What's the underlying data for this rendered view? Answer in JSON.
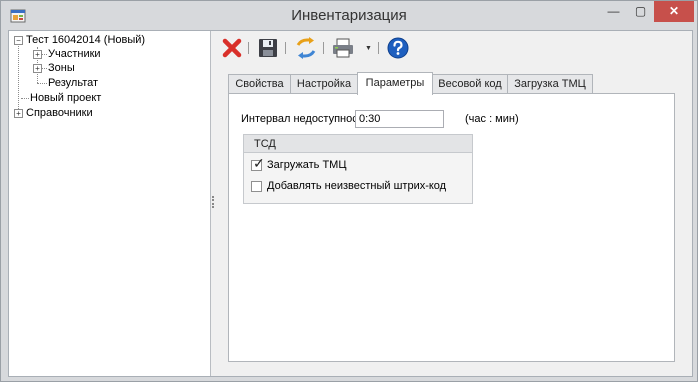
{
  "window": {
    "title": "Инвентаризация",
    "min_glyph": "—",
    "max_glyph": "▢",
    "close_glyph": "✕"
  },
  "tree": {
    "nodes": [
      {
        "label": "Тест 16042014 (Новый)",
        "expander": "−"
      },
      {
        "label": "Участники",
        "expander": "+"
      },
      {
        "label": "Зоны",
        "expander": "+"
      },
      {
        "label": "Результат"
      },
      {
        "label": "Новый проект"
      },
      {
        "label": "Справочники",
        "expander": "+"
      }
    ]
  },
  "toolbar": {
    "icons": [
      "delete-icon",
      "save-icon",
      "refresh-icon",
      "print-icon",
      "help-icon"
    ],
    "dropdown_glyph": "▼"
  },
  "tabs": [
    {
      "label": "Свойства",
      "active": false
    },
    {
      "label": "Настройка",
      "active": false
    },
    {
      "label": "Параметры",
      "active": true
    },
    {
      "label": "Весовой код",
      "active": false
    },
    {
      "label": "Загрузка ТМЦ",
      "active": false
    }
  ],
  "params": {
    "interval_label": "Интервал недоступности:",
    "interval_value": "0:30",
    "interval_unit": "(час : мин)"
  },
  "tsd": {
    "title": "ТСД",
    "load_tmc": {
      "label": "Загружать ТМЦ",
      "checked": true,
      "mark": "✓"
    },
    "add_unknown": {
      "label": "Добавлять неизвестный штрих-код",
      "checked": false
    }
  },
  "colors": {
    "close_button": "#c7504b",
    "delete_icon": "#d9302a",
    "help_icon": "#1e5fbf"
  }
}
